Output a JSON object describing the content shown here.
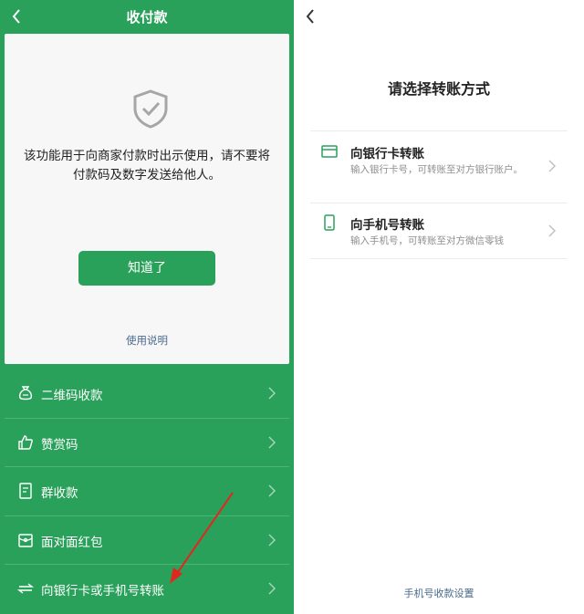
{
  "left": {
    "title": "收付款",
    "notice": "该功能用于向商家付款时出示使用，请不要将付款码及数字发送给他人。",
    "ok_button": "知道了",
    "help_link": "使用说明",
    "menu": [
      {
        "label": "二维码收款",
        "icon": "money-bag-icon"
      },
      {
        "label": "赞赏码",
        "icon": "thumbs-up-icon"
      },
      {
        "label": "群收款",
        "icon": "group-bill-icon"
      },
      {
        "label": "面对面红包",
        "icon": "red-packet-icon"
      },
      {
        "label": "向银行卡或手机号转账",
        "icon": "transfer-arrows-icon"
      }
    ]
  },
  "right": {
    "title": "请选择转账方式",
    "options": [
      {
        "title": "向银行卡转账",
        "desc": "输入银行卡号，可转账至对方银行账户。",
        "icon": "bank-card-icon"
      },
      {
        "title": "向手机号转账",
        "desc": "输入手机号，可转账至对方微信零钱",
        "icon": "mobile-phone-icon"
      }
    ],
    "footer_link": "手机号收款设置"
  },
  "colors": {
    "brand_green": "#2aa15a",
    "link_blue": "#4a6a8c",
    "annotation_red": "#e0281e"
  }
}
